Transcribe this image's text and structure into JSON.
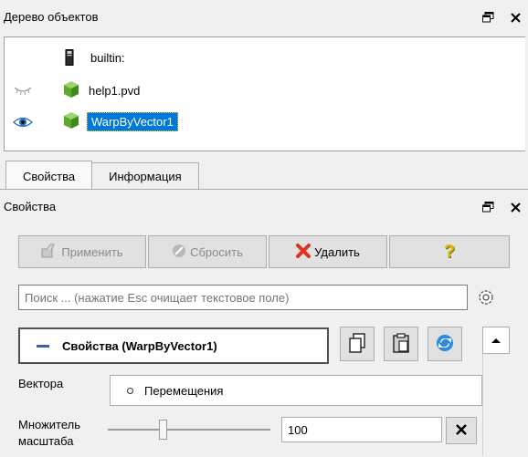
{
  "pipeline": {
    "title": "Дерево объектов",
    "items": [
      {
        "label": "builtin:",
        "icon": "server-icon"
      },
      {
        "label": "help1.pvd",
        "icon": "cube-icon",
        "visible": false
      },
      {
        "label": "WarpByVector1",
        "icon": "cube-icon",
        "visible": true,
        "selected": true
      }
    ]
  },
  "tabs": [
    {
      "label": "Свойства",
      "active": true
    },
    {
      "label": "Информация",
      "active": false
    }
  ],
  "properties": {
    "title": "Свойства",
    "buttons": {
      "apply": "Применить",
      "reset": "Сбросить",
      "delete": "Удалить",
      "help": "?"
    },
    "search_placeholder": "Поиск ... (нажатие Esc очищает текстовое поле)",
    "section_title": "Свойства (WarpByVector1)",
    "vectors_label": "Вектора",
    "vectors_value": "Перемещения",
    "scale_label": "Множитель\nмасштаба",
    "scale_value": "100"
  },
  "colors": {
    "selection": "#0078d7",
    "delete_icon": "#e03020",
    "help_icon": "#e0b800",
    "cube": "#6fbf3a"
  }
}
